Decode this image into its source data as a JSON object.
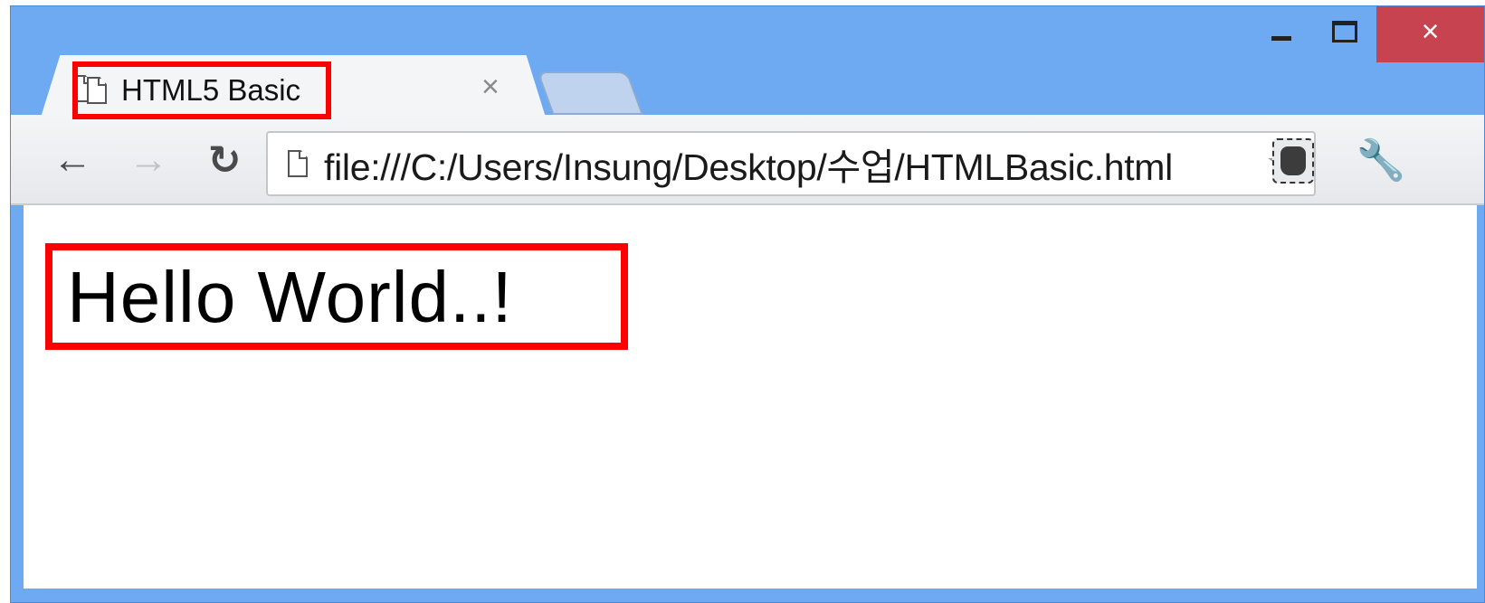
{
  "window": {
    "controls": {
      "minimize": "minimize",
      "maximize": "maximize",
      "close_glyph": "×"
    }
  },
  "tab": {
    "title": "HTML5 Basic",
    "close_glyph": "×",
    "icon": "page-icon"
  },
  "toolbar": {
    "back_glyph": "←",
    "forward_glyph": "→",
    "reload_glyph": "↻",
    "url": "file:///C:/Users/Insung/Desktop/수업/HTMLBasic.html",
    "star_glyph": "☆",
    "extension_icon": "evernote-icon",
    "wrench_glyph": "🔧"
  },
  "page": {
    "heading": "Hello World..!"
  },
  "colors": {
    "frame": "#6eaaf2",
    "highlight": "#ff0000",
    "close_button": "#c7434f"
  }
}
